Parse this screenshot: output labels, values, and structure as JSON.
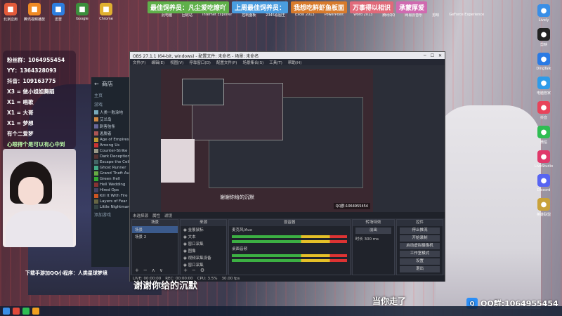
{
  "ticker": [
    {
      "text": "最佳饲养员：凡尘爱吃燎吖",
      "color": "#5fb04a"
    },
    {
      "text": "上周最佳饲养员：",
      "color": "#4a9de0"
    },
    {
      "text": "我想吃鲜虾鱼板面",
      "color": "#d87b2c"
    },
    {
      "text": "万事得以相识",
      "color": "#e06a7a"
    },
    {
      "text": "承蒙厚爱",
      "color": "#d06ab0"
    }
  ],
  "desktop_top": [
    {
      "label": "北京应用",
      "icon": "app-icon",
      "color": "#e45a3a"
    },
    {
      "label": "腾讯视频播放",
      "icon": "app-icon",
      "color": "#f08a24"
    },
    {
      "label": "迅雷",
      "icon": "app-icon",
      "color": "#2d7ee0"
    },
    {
      "label": "Google",
      "icon": "app-icon",
      "color": "#3c8f3c"
    },
    {
      "label": "Chrome",
      "icon": "app-icon",
      "color": "#e0b030"
    }
  ],
  "desktop_top2": [
    "此电脑",
    "回收站",
    "Internet Explorer",
    "控制面板",
    "2345看图王",
    "Excel 2013",
    "PowerPoint",
    "Word 2013",
    "腾讯QQ",
    "网易云音乐",
    "剪映",
    "GeForce Experience"
  ],
  "desktop_right": [
    {
      "label": "Lively",
      "color": "#3a8ee6"
    },
    {
      "label": "剪映",
      "color": "#222"
    },
    {
      "label": "DingTalk",
      "color": "#2a7ae4"
    },
    {
      "label": "电脑管家",
      "color": "#2f9be9"
    },
    {
      "label": "抖音",
      "color": "#e8435a"
    },
    {
      "label": "微信",
      "color": "#2fbd53"
    },
    {
      "label": "LiveStudio",
      "color": "#e0386a"
    },
    {
      "label": "Discord",
      "color": "#5865f2"
    },
    {
      "label": "英雄联盟",
      "color": "#c9a23a"
    }
  ],
  "left_card": {
    "rows": [
      "粉丝群：1064955454",
      "YY：1364328093",
      "抖音：109163775",
      "X3 = 做小姐姐舞蹈",
      "X1 = 唱歌",
      "X1 = 大哥",
      "X1 = 梦想"
    ],
    "footer_a": "有个二爱梦",
    "footer_b": "心眼得个是可以有心中到"
  },
  "left_bottom": "下载手游加QQ小程序：人类星球梦境",
  "steam": {
    "title": "商店",
    "section": "主页",
    "games_header": "游戏",
    "games": [
      {
        "name": "人类一败涂地",
        "color": "#7ab"
      },
      {
        "name": "艾兰岛",
        "color": "#c84"
      },
      {
        "name": "刺客信条",
        "color": "#669"
      },
      {
        "name": "逃脱者",
        "color": "#a55"
      },
      {
        "name": "Age of Empires",
        "color": "#b93"
      },
      {
        "name": "Among Us",
        "color": "#c33"
      },
      {
        "name": "Counter-Strike",
        "color": "#998"
      },
      {
        "name": "Dark Deception",
        "color": "#533"
      },
      {
        "name": "Escape the Ceiling",
        "color": "#466"
      },
      {
        "name": "Ghost Runner",
        "color": "#4a8"
      },
      {
        "name": "Grand Theft Auto",
        "color": "#6a4"
      },
      {
        "name": "Green Hell",
        "color": "#3a3"
      },
      {
        "name": "Hell Wedding",
        "color": "#833"
      },
      {
        "name": "Hired Ops",
        "color": "#446"
      },
      {
        "name": "Kill It With Fire",
        "color": "#c52"
      },
      {
        "name": "Layers of Fear",
        "color": "#664"
      },
      {
        "name": "Little Nightmares",
        "color": "#344"
      }
    ],
    "add_game": "添加游戏"
  },
  "obs": {
    "title": "OBS 27.1.1 (64-bit, windows) - 配置文件: 未命名 - 场景: 未命名",
    "menus": [
      "文件(F)",
      "编辑(E)",
      "视图(V)",
      "停靠窗口(D)",
      "配置文件(P)",
      "场景集合(S)",
      "工具(T)",
      "帮助(H)"
    ],
    "subtitle_preview": "谢谢你给的沉默",
    "status_src": "未选择源",
    "status_props": "属性",
    "status_filters": "滤镜",
    "docks": {
      "scenes": {
        "title": "场景",
        "items": [
          "场景",
          "场景 2"
        ]
      },
      "sources": {
        "title": "来源",
        "items": [
          "金展鼠标",
          "文本",
          "窗口采集",
          "图像",
          "视频采集设备",
          "窗口采集"
        ]
      },
      "mixer": {
        "title": "混音器",
        "channels": [
          "麦克风/Aux",
          "桌面音频"
        ]
      },
      "transitions": {
        "title": "转场特效",
        "type": "淡出",
        "duration_label": "时长",
        "duration": "300 ms"
      },
      "controls": {
        "title": "控件",
        "buttons": [
          "停止推流",
          "开始录制",
          "启动虚拟摄像机",
          "工作室模式",
          "设置",
          "退出"
        ]
      }
    },
    "statusbar": [
      "LIVE: 00:00:00",
      "REC: 00:00:00",
      "CPU: 3.5%",
      "30.00 fps"
    ]
  },
  "subtitle_main": "谢谢你给的沉默",
  "subtitle_right": "当你走了",
  "qq_tag": {
    "label": "QQ群:1064955454"
  }
}
